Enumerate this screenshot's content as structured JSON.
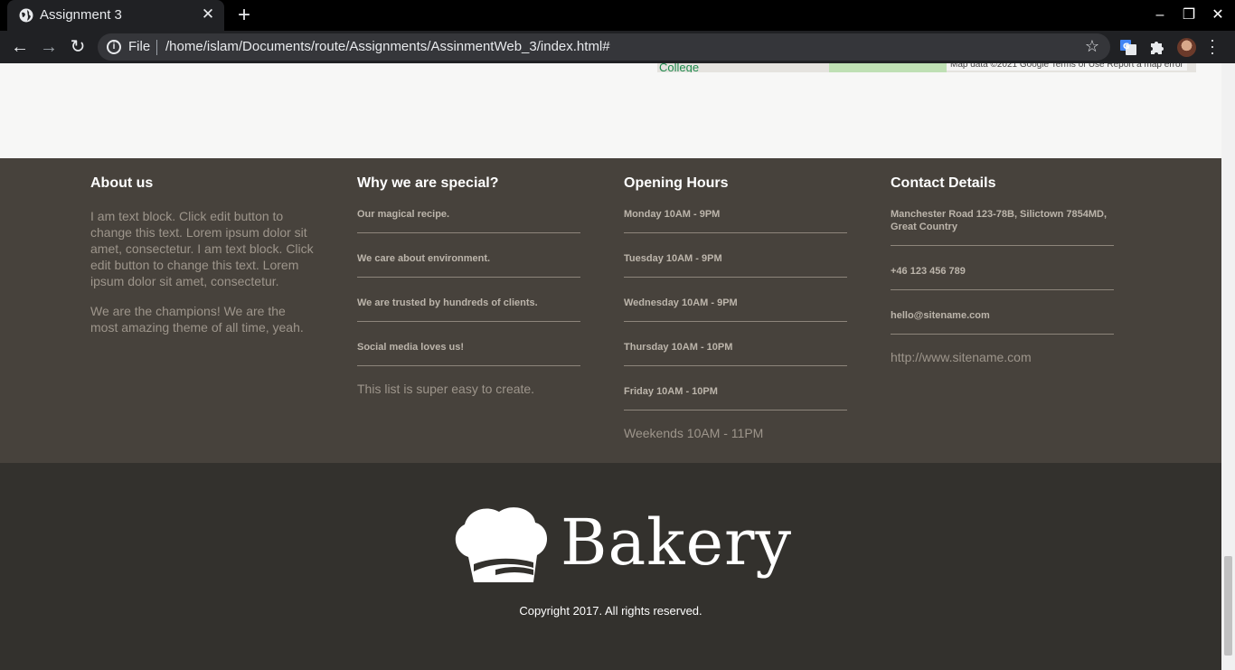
{
  "browser": {
    "tab_title": "Assignment 3",
    "url_scheme": "File",
    "url": "/home/islam/Documents/route/Assignments/AssinmentWeb_3/index.html#"
  },
  "map": {
    "place_label": "College",
    "credits": "Map data ©2021 Google   Terms of Use   Report a map error"
  },
  "footer_info": {
    "about": {
      "heading": "About us",
      "paragraphs": [
        "I am text block. Click edit button to change this text. Lorem ipsum dolor sit amet, consectetur. I am text block. Click edit button to change this text. Lorem ipsum dolor sit amet, consectetur.",
        "We are the champions! We are the most amazing theme of all time, yeah."
      ]
    },
    "special": {
      "heading": "Why we are special?",
      "items": [
        "Our magical recipe.",
        "We care about environment.",
        "We are trusted by hundreds of clients.",
        "Social media loves us!"
      ],
      "tail": "This list is super easy to create."
    },
    "hours": {
      "heading": "Opening Hours",
      "items": [
        "Monday 10AM - 9PM",
        "Tuesday 10AM - 9PM",
        "Wednesday 10AM - 9PM",
        "Thursday 10AM - 10PM",
        "Friday 10AM - 10PM"
      ],
      "tail": "Weekends 10AM - 11PM"
    },
    "contact": {
      "heading": "Contact Details",
      "items": [
        "Manchester Road 123-78B, Silictown 7854MD, Great Country",
        "+46 123 456 789",
        "hello@sitename.com"
      ],
      "tail": "http://www.sitename.com"
    }
  },
  "footer": {
    "logo_text": "Bakery",
    "copyright": "Copyright 2017. All rights reserved."
  },
  "icons": [
    "globe-icon",
    "close-icon",
    "plus-icon",
    "back-icon",
    "forward-icon",
    "reload-icon",
    "info-icon",
    "star-icon",
    "translate-icon",
    "puzzle-icon",
    "menu-icon",
    "chef-hat-icon"
  ]
}
